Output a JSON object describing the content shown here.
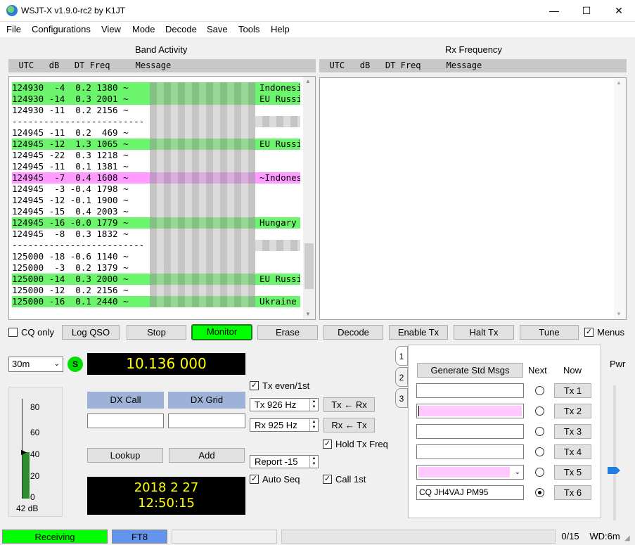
{
  "window": {
    "title": "WSJT-X   v1.9.0-rc2   by K1JT",
    "minimize": "—",
    "maximize": "☐",
    "close": "✕"
  },
  "menu": [
    "File",
    "Configurations",
    "View",
    "Mode",
    "Decode",
    "Save",
    "Tools",
    "Help"
  ],
  "band_activity": {
    "title": "Band Activity",
    "header": "  UTC   dB   DT Freq     Message",
    "rows": [
      {
        "text": "124930  -4  0.2 1380 ~",
        "right": "Indonesi",
        "style": "green"
      },
      {
        "text": "124930 -14  0.3 2001 ~",
        "right": "EU Russi",
        "style": "green"
      },
      {
        "text": "124930 -11  0.2 2156 ~",
        "right": "",
        "style": "plain"
      },
      {
        "text": "-------------------------",
        "right": "",
        "style": "sep"
      },
      {
        "text": "124945 -11  0.2  469 ~",
        "right": "",
        "style": "plain"
      },
      {
        "text": "124945 -12  1.3 1065 ~",
        "right": "EU Russi",
        "style": "green"
      },
      {
        "text": "124945 -22  0.3 1218 ~",
        "right": "",
        "style": "plain"
      },
      {
        "text": "124945 -11  0.1 1381 ~",
        "right": "",
        "style": "plain"
      },
      {
        "text": "124945  -7  0.4 1608 ~",
        "right": "~Indonesi",
        "style": "pink"
      },
      {
        "text": "124945  -3 -0.4 1798 ~",
        "right": "",
        "style": "plain"
      },
      {
        "text": "124945 -12 -0.1 1900 ~",
        "right": "",
        "style": "plain"
      },
      {
        "text": "124945 -15  0.4 2003 ~",
        "right": "",
        "style": "plain"
      },
      {
        "text": "124945 -16 -0.0 1779 ~",
        "right": "Hungary",
        "style": "green"
      },
      {
        "text": "124945  -8  0.3 1832 ~",
        "right": "",
        "style": "plain"
      },
      {
        "text": "-------------------------",
        "right": "",
        "style": "sep"
      },
      {
        "text": "125000 -18 -0.6 1140 ~",
        "right": "",
        "style": "plain"
      },
      {
        "text": "125000  -3  0.2 1379 ~",
        "right": "",
        "style": "plain"
      },
      {
        "text": "125000 -14  0.3 2000 ~",
        "right": "EU Russi",
        "style": "green"
      },
      {
        "text": "125000 -12  0.2 2156 ~",
        "right": "",
        "style": "plain"
      },
      {
        "text": "125000 -16  0.1 2440 ~",
        "right": "Ukraine",
        "style": "green"
      }
    ]
  },
  "rx_frequency": {
    "title": "Rx Frequency",
    "header": "  UTC   dB   DT Freq     Message"
  },
  "controls": {
    "cq_only": "CQ only",
    "log_qso": "Log QSO",
    "stop": "Stop",
    "monitor": "Monitor",
    "erase": "Erase",
    "decode": "Decode",
    "enable_tx": "Enable Tx",
    "halt_tx": "Halt Tx",
    "tune": "Tune",
    "menus": "Menus"
  },
  "band": "30m",
  "s_badge": "S",
  "dial_frequency": "10.136 000",
  "dx": {
    "call_label": "DX Call",
    "grid_label": "DX Grid",
    "call_value": "",
    "grid_value": "",
    "lookup": "Lookup",
    "add": "Add"
  },
  "meter": {
    "ticks": [
      "80",
      "60",
      "40",
      "20",
      "0"
    ],
    "level_db": 42,
    "reading": "42 dB"
  },
  "datetime": {
    "date": "2018 2 27",
    "time": "12:50:15"
  },
  "tx_options": {
    "tx_even": "Tx even/1st",
    "tx_freq": "Tx  926  Hz",
    "rx_freq": "Rx  925  Hz",
    "tx_from_rx": "Tx ← Rx",
    "rx_from_tx": "Rx ← Tx",
    "hold_tx_freq": "Hold Tx Freq",
    "report": "Report -15",
    "auto_seq": "Auto Seq",
    "call_1st": "Call 1st"
  },
  "tabs": [
    "1",
    "2",
    "3"
  ],
  "messages": {
    "generate": "Generate Std Msgs",
    "next_label": "Next",
    "now_label": "Now",
    "tx_buttons": [
      "Tx 1",
      "Tx 2",
      "Tx 3",
      "Tx 4",
      "Tx 5",
      "Tx 6"
    ],
    "tx6_text": "CQ JH4VAJ PM95"
  },
  "pwr_label": "Pwr",
  "statusbar": {
    "receiving": "Receiving",
    "mode": "FT8",
    "progress": "0/15",
    "wd": "WD:6m"
  },
  "colors": {
    "green_row": "#6cf56c",
    "pink_row": "#ff9cff",
    "freq_text": "#ffff00",
    "status_green": "#00ff00",
    "mode_blue": "#6495ed"
  }
}
